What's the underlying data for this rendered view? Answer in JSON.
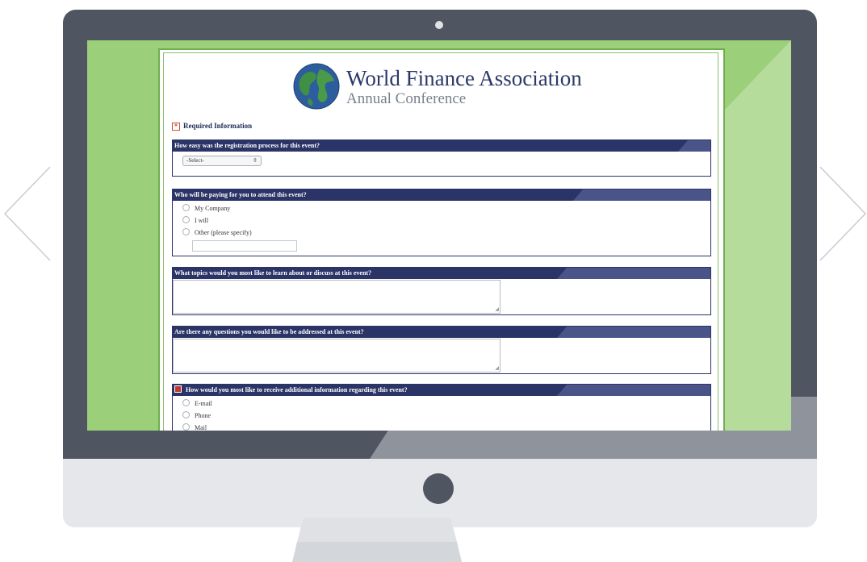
{
  "org": {
    "name": "World Finance Association",
    "subtitle": "Annual Conference"
  },
  "required_note": "Required Information",
  "questions": {
    "q1": {
      "label": "How easy was the registration process for this event?",
      "select_value": "-Select-"
    },
    "q2": {
      "label": "Who will be paying for you to attend this event?",
      "options": [
        "My Company",
        "I will",
        "Other (please specify)"
      ]
    },
    "q3": {
      "label": "What topics would you most like to learn about or discuss at this event?"
    },
    "q4": {
      "label": "Are there any questions you would like to be addressed at this event?"
    },
    "q5": {
      "label": "How would you most like to receive additional information regarding this event?",
      "options": [
        "E-mail",
        "Phone",
        "Mail"
      ]
    }
  },
  "colors": {
    "header_navy": "#2a3466",
    "screen_green": "#9ccf79",
    "bezel": "#4f5561",
    "required_red": "#c0392b"
  },
  "icons": {
    "left_arrow": "chevron-left-icon",
    "right_arrow": "chevron-right-icon",
    "logo": "globe-icon"
  }
}
